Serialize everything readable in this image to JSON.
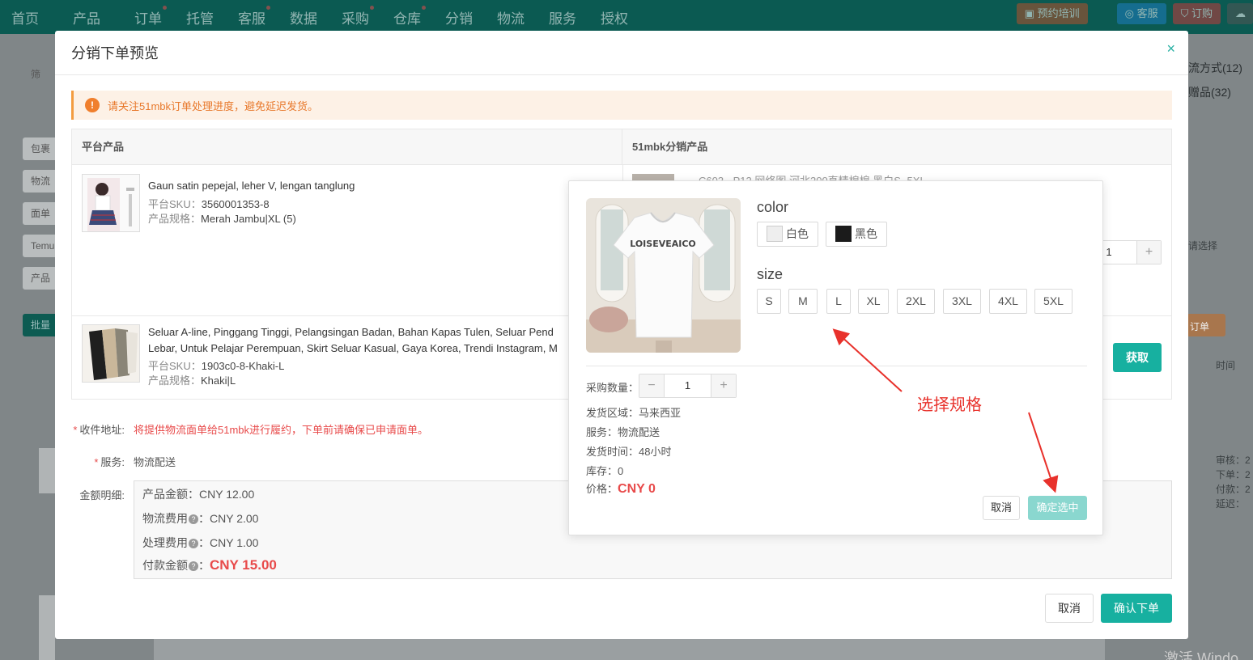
{
  "topnav": {
    "items": [
      "首页",
      "产品",
      "订单",
      "托管",
      "客服",
      "数据",
      "采购",
      "仓库",
      "分销",
      "物流",
      "服务",
      "授权"
    ],
    "right": {
      "training": "预约培训",
      "cs": "客服",
      "subscribe": "订购",
      "cloud": ""
    }
  },
  "background": {
    "left_chips": [
      "筛",
      "包裹",
      "物流",
      "面单",
      "Temu",
      "产品",
      "批量"
    ],
    "right_labels": [
      "流方式(12)",
      "赠品(32)",
      "请选择",
      "订单",
      "时间"
    ],
    "right_stats": [
      "审核：2",
      "下单：2",
      "付款：2",
      "延迟："
    ],
    "watermark": "激活 Windo"
  },
  "modal": {
    "title": "分销下单预览",
    "close": "×",
    "alert": "请关注51mbk订单处理进度，避免延迟发货。",
    "table": {
      "col_left": "平台产品",
      "col_right": "51mbk分销产品",
      "rows": [
        {
          "title": "Gaun satin pepejal, leher V, lengan tanglung",
          "sku_label": "平台SKU：",
          "sku": "3560001353-8",
          "spec_label": "产品规格：",
          "spec": "Merah Jambu|XL (5)",
          "dist_title": "C603 - P12 网络图 河北200直精棉棉 黑白S~5XL",
          "qty": "1"
        },
        {
          "title_line1": "Seluar A-line, Pinggang Tinggi, Pelangsingan Badan, Bahan Kapas Tulen, Seluar Pend",
          "title_line2": "Lebar, Untuk Pelajar Perempuan, Skirt Seluar Kasual, Gaya Korea, Trendi Instagram, M",
          "sku_label": "平台SKU：",
          "sku": "1903c0-8-Khaki-L",
          "spec_label": "产品规格：",
          "spec": "Khaki|L",
          "fetch": "获取"
        }
      ]
    },
    "address_label": "收件地址:",
    "address_note": "将提供物流面单给51mbk进行履约，下单前请确保已申请面单。",
    "service_label": "服务:",
    "service_value": "物流配送",
    "amount_label": "金额明细:",
    "amounts": {
      "product_label": "产品金额：",
      "product": "CNY 12.00",
      "logistics_label": "物流费用",
      "logistics": "：CNY 2.00",
      "handling_label": "处理费用",
      "handling": "：CNY 1.00",
      "total_label": "付款金额",
      "total": "CNY 15.00",
      "q": "?"
    },
    "cancel": "取消",
    "confirm": "确认下单"
  },
  "popover": {
    "color_title": "color",
    "colors": [
      "白色",
      "黑色"
    ],
    "size_title": "size",
    "sizes": [
      "S",
      "M",
      "L",
      "XL",
      "2XL",
      "3XL",
      "4XL",
      "5XL"
    ],
    "qty_label": "采购数量：",
    "qty": "1",
    "minus": "−",
    "plus": "+",
    "region": "发货区域：马来西亚",
    "service": "服务：物流配送",
    "ship_time": "发货时间：48小时",
    "stock": "库存：0",
    "price_label": "价格：",
    "price": "CNY 0",
    "cancel": "取消",
    "confirm": "确定选中",
    "shirt_print": "LOISEVEAICO"
  },
  "annotation": "选择规格",
  "colors": {
    "accent": "#17b0a0",
    "nav": "#0b5a52",
    "red": "#e84a4a",
    "alert_orange": "#e8782b"
  }
}
